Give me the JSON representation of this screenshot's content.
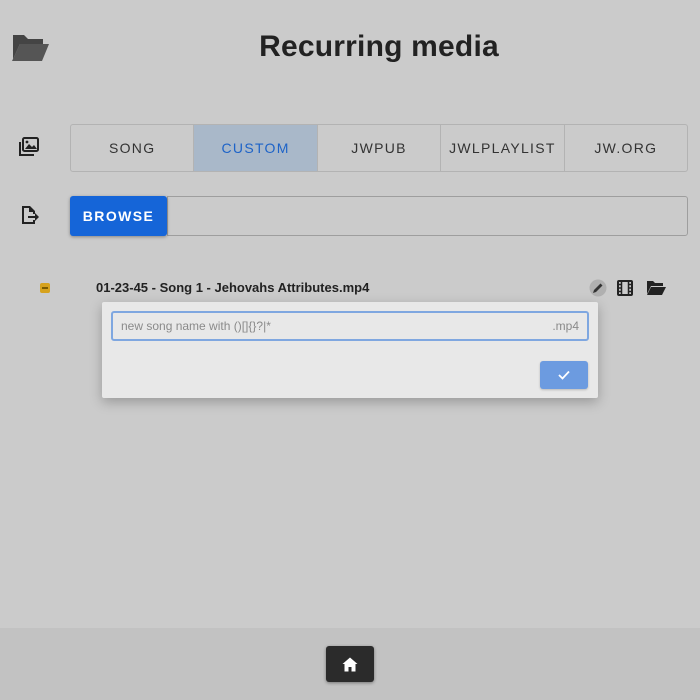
{
  "header": {
    "title": "Recurring media",
    "icon": "folder-open-icon"
  },
  "tabs": [
    {
      "label": "SONG",
      "active": false
    },
    {
      "label": "CUSTOM",
      "active": true
    },
    {
      "label": "JWPUB",
      "active": false
    },
    {
      "label": "JWLPLAYLIST",
      "active": false
    },
    {
      "label": "JW.ORG",
      "active": false
    }
  ],
  "browse": {
    "button_label": "BROWSE",
    "field_value": ""
  },
  "file": {
    "name": "01-23-45 - Song 1 - Jehovahs Attributes.mp4",
    "actions": [
      "pencil-icon",
      "film-icon",
      "folder-open-icon"
    ]
  },
  "rename_dialog": {
    "placeholder": "new song name with ()[]{}?|*",
    "extension": ".mp4",
    "confirm_icon": "check-icon"
  },
  "footer": {
    "home_icon": "home-icon"
  },
  "colors": {
    "background": "#cbcbcb",
    "active_tab_bg": "#a9b8c9",
    "active_tab_text": "#1d63c8",
    "primary_button": "#1565d8",
    "confirm_button": "#6c9be0",
    "status_yellow": "#d6a21d",
    "home_button": "#2b2b2b"
  }
}
